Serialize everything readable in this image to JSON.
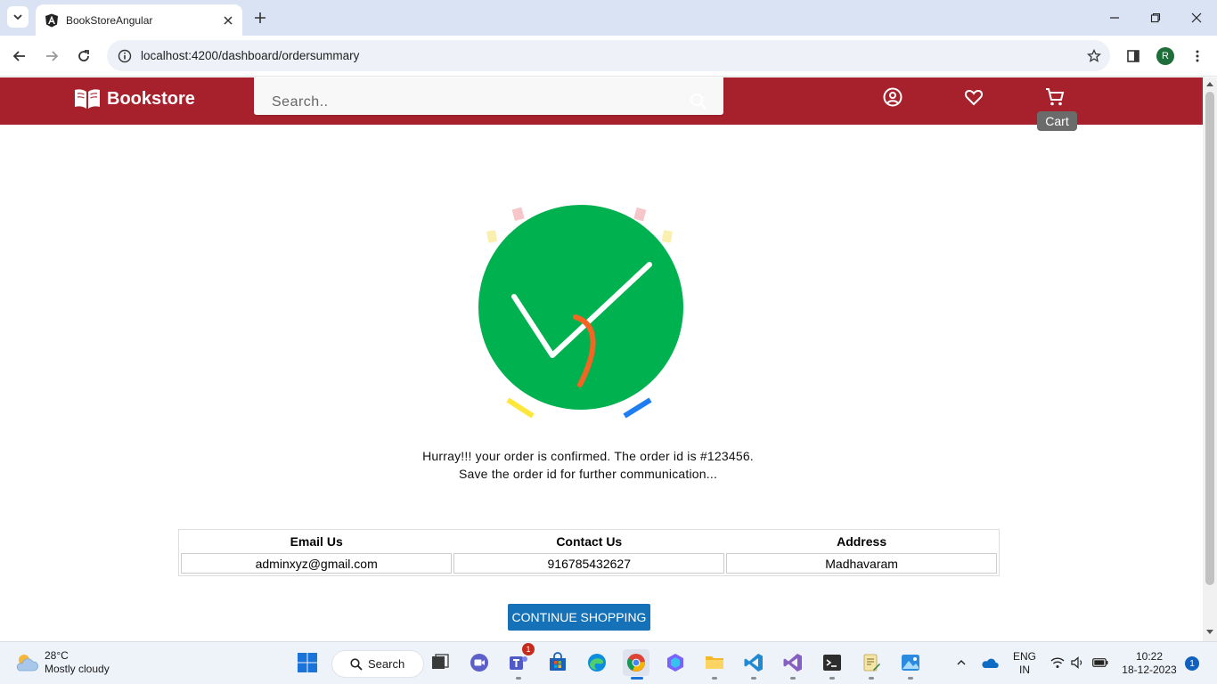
{
  "browser": {
    "tab_title": "BookStoreAngular",
    "url": "localhost:4200/dashboard/ordersummary",
    "profile_initial": "R"
  },
  "header": {
    "brand": "Bookstore",
    "search_placeholder": "Search..",
    "cart_tooltip": "Cart",
    "icons": [
      "profile-icon",
      "wishlist-heart-icon",
      "cart-icon"
    ],
    "color": "#a6212c"
  },
  "order": {
    "message_line1": "Hurray!!! your order is confirmed. The order id is #123456.",
    "message_line2": "Save the order id for further communication..."
  },
  "contact_table": {
    "headers": [
      "Email Us",
      "Contact Us",
      "Address"
    ],
    "values": [
      "adminxyz@gmail.com",
      "916785432627",
      "Madhavaram"
    ]
  },
  "continue_button": "CONTINUE SHOPPING",
  "taskbar": {
    "weather_temp": "28°C",
    "weather_desc": "Mostly cloudy",
    "search_label": "Search",
    "teams_badge": "1",
    "language": "ENG",
    "region": "IN",
    "time": "10:22",
    "date": "18-12-2023",
    "notification_count": "1"
  }
}
